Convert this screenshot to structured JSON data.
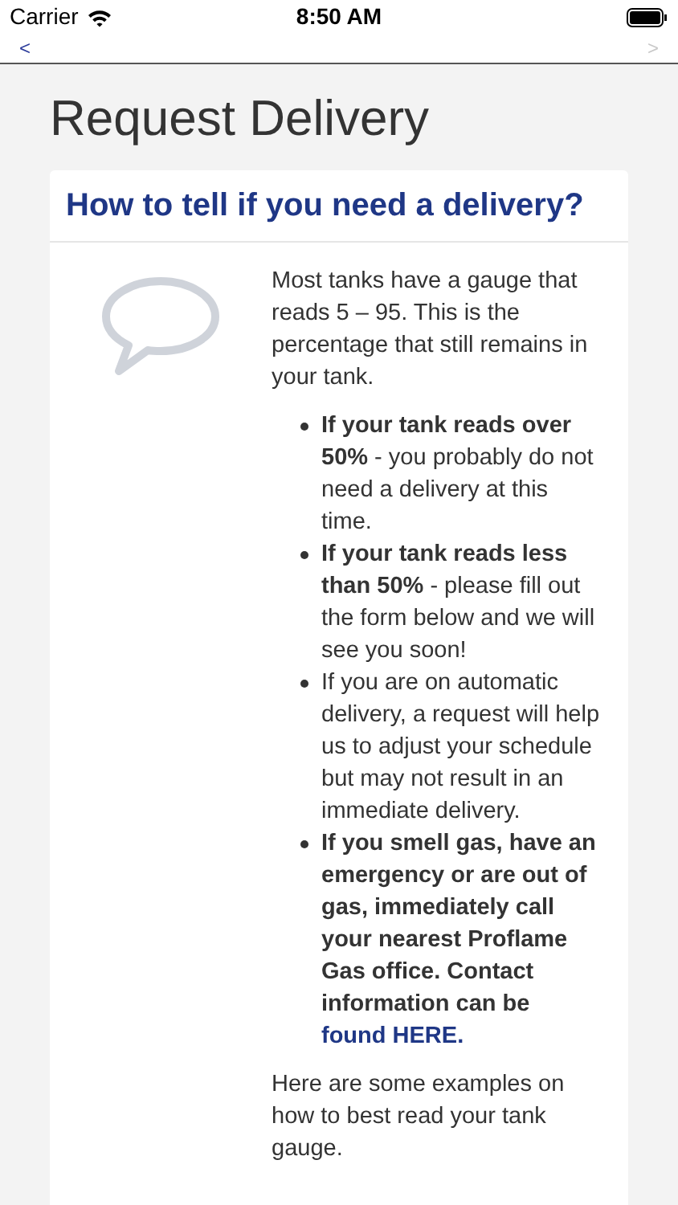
{
  "status_bar": {
    "carrier": "Carrier",
    "time": "8:50 AM"
  },
  "nav": {
    "back": {
      "label": "<",
      "disabled": false
    },
    "forward": {
      "label": ">",
      "disabled": true
    }
  },
  "page_title": "Request Delivery",
  "card": {
    "heading": "How to tell if you need a delivery?",
    "intro": "Most tanks have a gauge that reads 5 – 95. This is the percentage that still remains in your tank.",
    "bullets": [
      {
        "text": "**If your tank reads over 50%** - you probably do not need a delivery at this time.",
        "bold": false
      },
      {
        "text": "**If your tank reads less than 50%** - please fill out the form below and we will see you soon!",
        "bold": false
      },
      {
        "text": "If you are on automatic delivery, a request will help us to adjust your schedule but may not result in an immediate delivery.",
        "bold": false
      },
      {
        "text": "If you smell gas, have an emergency or are out of gas, immediately call your nearest Proflame Gas office. Contact information can be",
        "bold": true,
        "link": "found HERE."
      }
    ],
    "outro": "Here are some examples on how to best read your tank gauge."
  }
}
